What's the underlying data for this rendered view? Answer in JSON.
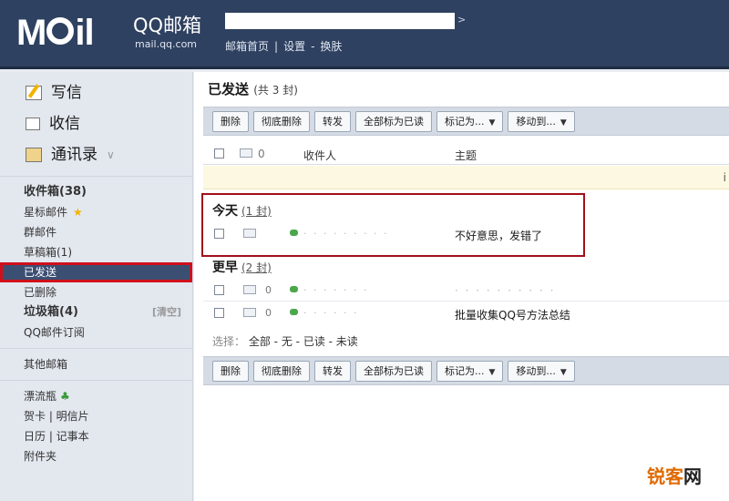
{
  "header": {
    "logo": "M",
    "logo_tail": "il",
    "brand": "QQ邮箱",
    "brand_sub": "mail.qq.com",
    "top_links": [
      "邮箱首页",
      "|",
      "设置",
      "-",
      "换肤"
    ]
  },
  "sidebar": {
    "quick": [
      {
        "label": "写信",
        "icon": "pencil-icon"
      },
      {
        "label": "收信",
        "icon": "inbox-icon"
      },
      {
        "label": "通讯录",
        "icon": "contacts-icon"
      }
    ],
    "folders": [
      {
        "label": "收件箱(38)",
        "bold": true
      },
      {
        "label": "星标邮件",
        "star": "★"
      },
      {
        "label": "群邮件"
      },
      {
        "label": "草稿箱(1)"
      },
      {
        "label": "已发送",
        "active": true
      },
      {
        "label": "已删除"
      },
      {
        "label": "垃圾箱(4)",
        "bold": true,
        "clear": "[清空]"
      },
      {
        "label": "QQ邮件订阅"
      }
    ],
    "other": "其他邮箱",
    "tools": [
      "漂流瓶",
      "贺卡 | 明信片",
      "日历 | 记事本",
      "附件夹"
    ]
  },
  "main": {
    "title": "已发送",
    "count": "(共 3 封)",
    "toolbar": {
      "delete": "删除",
      "delete_perm": "彻底删除",
      "forward": "转发",
      "mark_all_read": "全部标为已读",
      "mark_as": "标记为...",
      "move_to": "移动到..."
    },
    "columns": {
      "recipient": "收件人",
      "subject": "主题"
    },
    "notice_dot": "i",
    "groups": {
      "today": {
        "label": "今天",
        "count": "(1 封)"
      },
      "earlier": {
        "label": "更早",
        "count": "(2 封)"
      }
    },
    "rows": [
      {
        "sender": "· · · · · · · · ·",
        "subject": "不好意思，发错了"
      },
      {
        "sender": "· · · · · · ·",
        "subject": "· · · · · · · · · ·"
      },
      {
        "sender": "· · · · · ·",
        "subject": "批量收集QQ号方法总结"
      }
    ],
    "select": {
      "label": "选择：",
      "all": "全部",
      "none": "无",
      "read": "已读",
      "unread": "未读"
    }
  },
  "watermark": {
    "brand_a": "锐客",
    "brand_b": "网"
  }
}
